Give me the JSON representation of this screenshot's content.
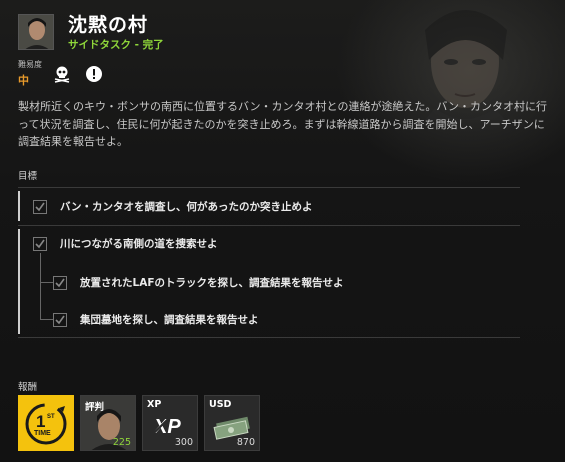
{
  "mission": {
    "title": "沈黙の村",
    "subtitle": "サイドタスク - 完了",
    "difficulty_label": "難易度",
    "difficulty_value": "中",
    "modifiers": [
      "skull-crossbones-icon",
      "alert-icon"
    ],
    "description": "製材所近くのキウ・ボンサの南西に位置するバン・カンタオ村との連絡が途絶えた。バン・カンタオ村に行って状況を調査し、住民に何が起きたのかを突き止めろ。まずは幹線道路から調査を開始し、アーチザンに調査結果を報告せよ。"
  },
  "objectives": {
    "label": "目標",
    "items": [
      {
        "text": "バン・カンタオを調査し、何があったのか突き止めよ",
        "checked": true,
        "level": 0
      },
      {
        "text": "川につながる南側の道を捜索せよ",
        "checked": true,
        "level": 0
      },
      {
        "text": "放置されたLAFのトラックを探し、調査結果を報告せよ",
        "checked": true,
        "level": 1
      },
      {
        "text": "集団墓地を探し、調査結果を報告せよ",
        "checked": true,
        "level": 1
      }
    ]
  },
  "rewards": {
    "label": "報酬",
    "items": [
      {
        "type": "first-time",
        "badge_top": "1",
        "badge_sup": "ST",
        "badge_bottom": "TIME"
      },
      {
        "type": "reputation",
        "label": "評判",
        "value": "225"
      },
      {
        "type": "xp",
        "label": "XP",
        "value": "300",
        "logo": "XP"
      },
      {
        "type": "usd",
        "label": "USD",
        "value": "870"
      }
    ]
  },
  "colors": {
    "accent_green": "#8fd63a",
    "difficulty_orange": "#e89a2b",
    "first_time_yellow": "#f4c20d"
  }
}
